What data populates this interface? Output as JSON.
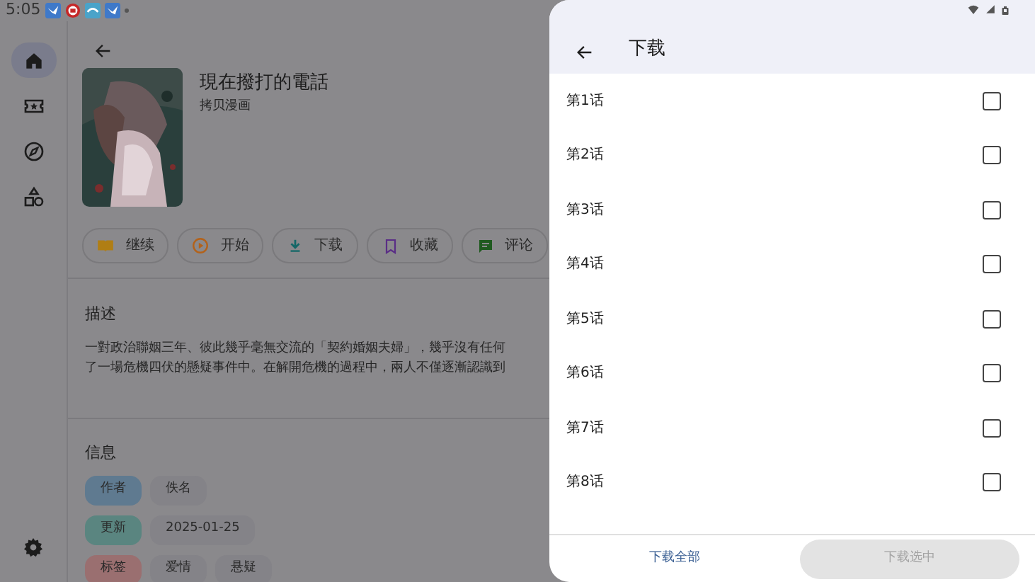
{
  "status_bar": {
    "time": "5:05",
    "notifications": [
      {
        "kind": "bird",
        "color": "#3f79c9"
      },
      {
        "kind": "badge",
        "color": "#c62828"
      },
      {
        "kind": "app",
        "color": "#4aa3c9"
      },
      {
        "kind": "bird",
        "color": "#3f79c9"
      }
    ]
  },
  "nav_rail": [
    {
      "kind": "home",
      "selected": true
    },
    {
      "kind": "ticket",
      "selected": false
    },
    {
      "kind": "compass",
      "selected": false
    },
    {
      "kind": "shapes",
      "selected": false
    }
  ],
  "comic": {
    "title": "現在撥打的電話",
    "source": "拷贝漫画",
    "actions": [
      {
        "label": "继续",
        "kind": "book",
        "color": "#b07e14"
      },
      {
        "label": "开始",
        "kind": "play",
        "color": "#b3621a"
      },
      {
        "label": "下载",
        "kind": "download",
        "color": "#146767"
      },
      {
        "label": "收藏",
        "kind": "bookmark",
        "color": "#5a2d86"
      },
      {
        "label": "评论",
        "kind": "comment",
        "color": "#1f5a1f"
      }
    ],
    "description": {
      "heading": "描述",
      "lines": [
        "一對政治聯姻三年、彼此幾乎毫無交流的「契約婚姻夫婦」，幾乎沒有任何",
        "了一場危機四伏的懸疑事件中。在解開危機的過程中，兩人不僅逐漸認識到"
      ]
    },
    "info": {
      "heading": "信息",
      "rows": [
        {
          "label": "作者",
          "color": "#5f7a90",
          "values": [
            "佚名"
          ]
        },
        {
          "label": "更新",
          "color": "#5a8580",
          "values": [
            "2025-01-25"
          ]
        },
        {
          "label": "标签",
          "color": "#9a6f70",
          "values": [
            "爱情",
            "悬疑"
          ]
        }
      ]
    }
  },
  "download_drawer": {
    "title": "下载",
    "chapters": [
      {
        "label": "第1话",
        "checked": false
      },
      {
        "label": "第2话",
        "checked": false
      },
      {
        "label": "第3话",
        "checked": false
      },
      {
        "label": "第4话",
        "checked": false
      },
      {
        "label": "第5话",
        "checked": false
      },
      {
        "label": "第6话",
        "checked": false
      },
      {
        "label": "第7话",
        "checked": false
      },
      {
        "label": "第8话",
        "checked": false
      }
    ],
    "download_all": "下载全部",
    "download_selected": {
      "label": "下载选中",
      "disabled": true
    }
  }
}
